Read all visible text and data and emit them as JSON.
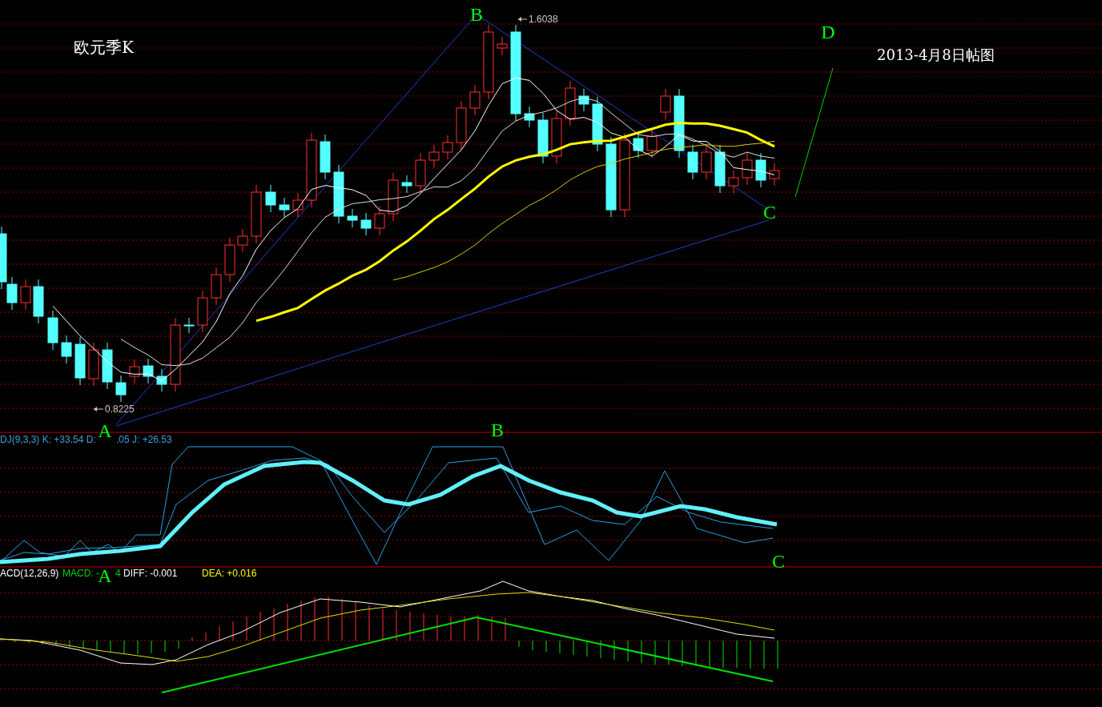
{
  "chart_title": "欧元季K",
  "date_note": "2013-4月8日帖图",
  "price_labels": [
    {
      "text": "1.6038"
    },
    {
      "text": "0.8225"
    }
  ],
  "wave_labels": [
    {
      "text": "B"
    },
    {
      "text": "D"
    },
    {
      "text": "C"
    },
    {
      "text": "A"
    },
    {
      "text": "B"
    },
    {
      "text": "C"
    },
    {
      "text": "A"
    }
  ],
  "kdj_legend": [
    {
      "text": "DJ(9,3,3) K: +33.54 D:"
    },
    {
      "text": ".05 J: +26.53"
    }
  ],
  "macd_legend": [
    {
      "kind": "name",
      "text": "ACD(12,26,9)"
    },
    {
      "kind": "macd",
      "text": "MACD: -"
    },
    {
      "kind": "macd",
      "text": "4"
    },
    {
      "kind": "diff",
      "text": "DIFF: -0.001"
    },
    {
      "kind": "dea",
      "text": "DEA: +0.016"
    }
  ]
}
